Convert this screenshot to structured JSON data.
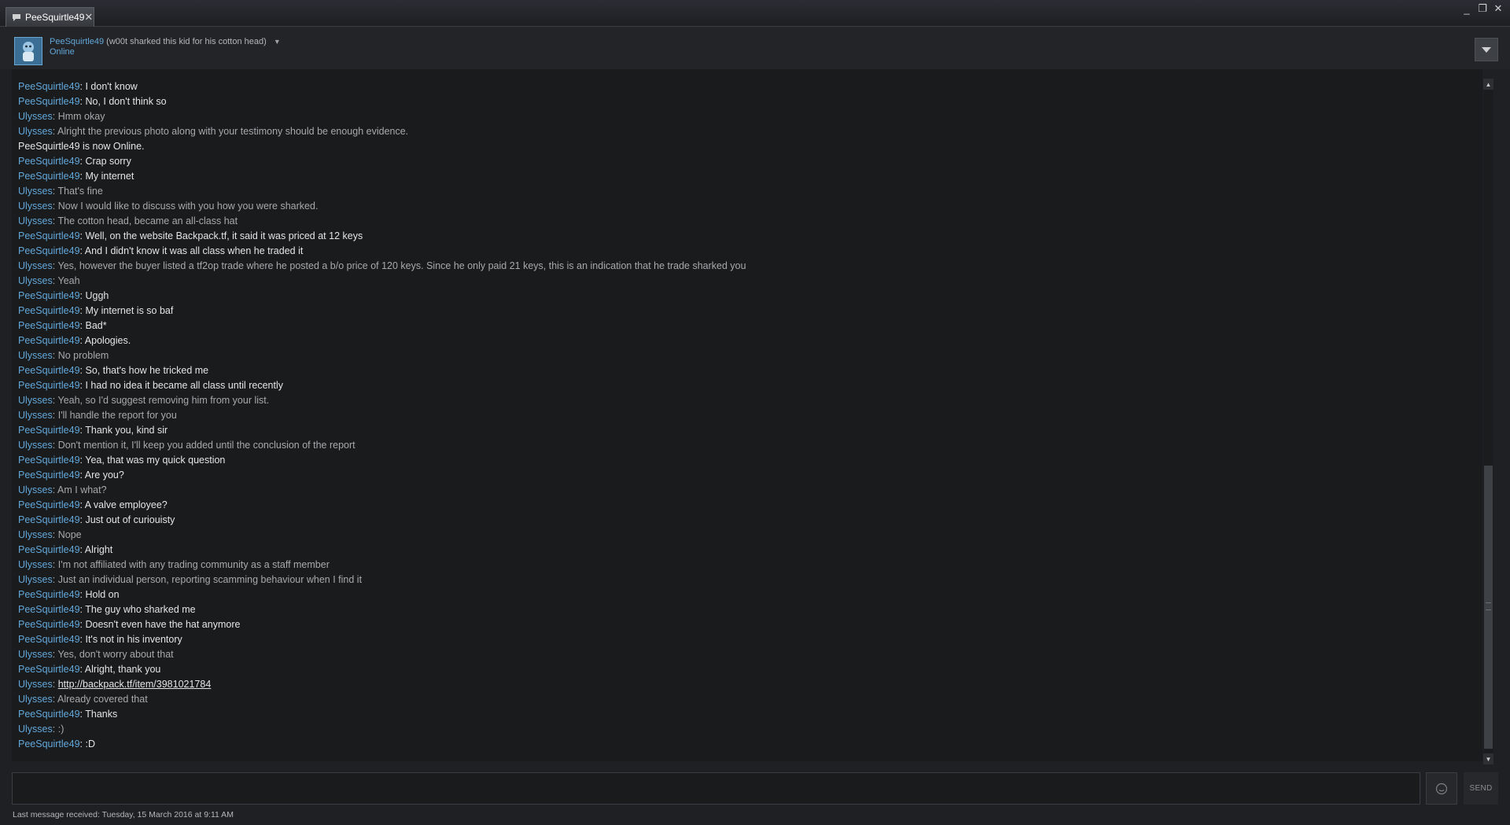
{
  "tab": {
    "title": "PeeSquirtle49",
    "close_glyph": "✕"
  },
  "window_controls": {
    "minimize": "_",
    "maximize": "❐",
    "close": "✕"
  },
  "friend": {
    "name": "PeeSquirtle49",
    "nickname": "(w00t sharked this kid for his cotton head)",
    "status": "Online"
  },
  "messages": [
    {
      "speaker": "PeeSquirtle49",
      "text": "I don't know"
    },
    {
      "speaker": "PeeSquirtle49",
      "text": "No, I don't think so"
    },
    {
      "speaker": "Ulysses",
      "text": "Hmm okay"
    },
    {
      "speaker": "Ulysses",
      "text": "Alright the previous photo along with your testimony should be enough evidence."
    },
    {
      "system": "PeeSquirtle49 is now Online."
    },
    {
      "speaker": "PeeSquirtle49",
      "text": "Crap sorry"
    },
    {
      "speaker": "PeeSquirtle49",
      "text": "My internet"
    },
    {
      "speaker": "Ulysses",
      "text": "That's fine"
    },
    {
      "speaker": "Ulysses",
      "text": "Now I would like to discuss with you how you were sharked."
    },
    {
      "speaker": "Ulysses",
      "text": "The cotton head, became an all-class hat"
    },
    {
      "speaker": "PeeSquirtle49",
      "text": "Well, on the website Backpack.tf, it said it was priced at 12 keys"
    },
    {
      "speaker": "PeeSquirtle49",
      "text": "And I didn't know it was all class when he traded it"
    },
    {
      "speaker": "Ulysses",
      "text": "Yes, however the buyer listed a tf2op trade where he posted a b/o price of 120 keys. Since he only paid 21 keys, this is an indication that he trade sharked you"
    },
    {
      "speaker": "Ulysses",
      "text": "Yeah"
    },
    {
      "speaker": "PeeSquirtle49",
      "text": "Uggh"
    },
    {
      "speaker": "PeeSquirtle49",
      "text": "My internet is so baf"
    },
    {
      "speaker": "PeeSquirtle49",
      "text": "Bad*"
    },
    {
      "speaker": "PeeSquirtle49",
      "text": "Apologies."
    },
    {
      "speaker": "Ulysses",
      "text": "No problem"
    },
    {
      "speaker": "PeeSquirtle49",
      "text": "So, that's how he tricked me"
    },
    {
      "speaker": "PeeSquirtle49",
      "text": "I had no idea it became all class until recently"
    },
    {
      "speaker": "Ulysses",
      "text": "Yeah, so I'd suggest removing him from your list."
    },
    {
      "speaker": "Ulysses",
      "text": "I'll handle the report for you"
    },
    {
      "speaker": "PeeSquirtle49",
      "text": "Thank you, kind sir"
    },
    {
      "speaker": "Ulysses",
      "text": "Don't mention it, I'll keep you added until the conclusion of the report"
    },
    {
      "speaker": "PeeSquirtle49",
      "text": "Yea, that was my quick question"
    },
    {
      "speaker": "PeeSquirtle49",
      "text": "Are you?"
    },
    {
      "speaker": "Ulysses",
      "text": "Am I what?"
    },
    {
      "speaker": "PeeSquirtle49",
      "text": "A valve employee?"
    },
    {
      "speaker": "PeeSquirtle49",
      "text": "Just out of curiouisty"
    },
    {
      "speaker": "Ulysses",
      "text": "Nope"
    },
    {
      "speaker": "PeeSquirtle49",
      "text": "Alright"
    },
    {
      "speaker": "Ulysses",
      "text": "I'm not affiliated with any trading community as a staff member"
    },
    {
      "speaker": "Ulysses",
      "text": "Just an individual person, reporting scamming behaviour when I find it"
    },
    {
      "speaker": "PeeSquirtle49",
      "text": "Hold on"
    },
    {
      "speaker": "PeeSquirtle49",
      "text": "The guy who sharked me"
    },
    {
      "speaker": "PeeSquirtle49",
      "text": "Doesn't even have the hat anymore"
    },
    {
      "speaker": "PeeSquirtle49",
      "text": "It's not in his inventory"
    },
    {
      "speaker": "Ulysses",
      "text": "Yes, don't worry about that"
    },
    {
      "speaker": "PeeSquirtle49",
      "text": "Alright, thank you"
    },
    {
      "speaker": "Ulysses",
      "link": "http://backpack.tf/item/3981021784"
    },
    {
      "speaker": "Ulysses",
      "text": "Already covered that"
    },
    {
      "speaker": "PeeSquirtle49",
      "text": "Thanks"
    },
    {
      "speaker": "Ulysses",
      "text": ":)"
    },
    {
      "speaker": "PeeSquirtle49",
      "text": ":D"
    }
  ],
  "input": {
    "placeholder": ""
  },
  "send_label": "SEND",
  "footer": {
    "last_message": "Last message received: Tuesday, 15 March 2016 at 9:11 AM"
  },
  "colors": {
    "speaker": "#62a8da",
    "self_text": "#e4e5e6",
    "other_text": "#a7a9ab",
    "background": "#1f2023"
  }
}
